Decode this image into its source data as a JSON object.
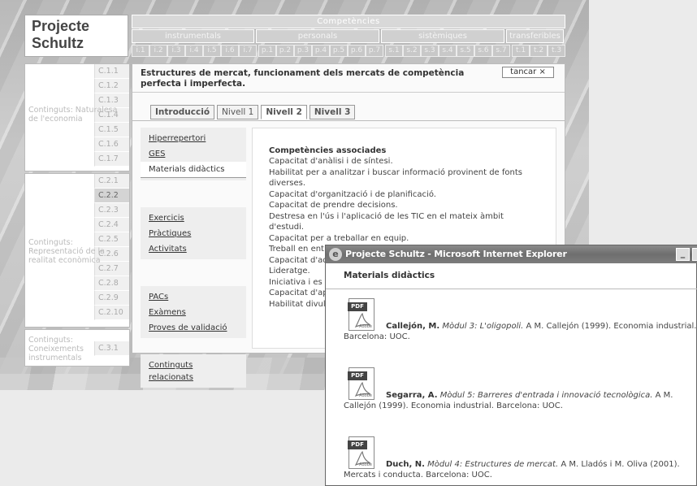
{
  "logo": {
    "line1": "Projecte",
    "line2": "Schultz"
  },
  "competencies": {
    "title": "Competències",
    "categories": [
      "instrumentals",
      "personals",
      "sistèmiques",
      "transferibles"
    ],
    "codes": [
      "i.1",
      "i.2",
      "i.3",
      "i.4",
      "i.5",
      "i.6",
      "i.7",
      "p.1",
      "p.2",
      "p.3",
      "p.4",
      "p.5",
      "p.6",
      "p.7",
      "s.1",
      "s.2",
      "s.3",
      "s.4",
      "s.5",
      "s.6",
      "s.7",
      "t.1",
      "t.2",
      "t.3"
    ]
  },
  "sections": [
    {
      "label": "Continguts: Naturalesa de l'economia",
      "codes": [
        "C.1.1",
        "C.1.2",
        "C.1.3",
        "C.1.4",
        "C.1.5",
        "C.1.6",
        "C.1.7"
      ]
    },
    {
      "label": "Continguts: Representació de la realitat econòmica",
      "codes": [
        "C.2.1",
        "C.2.2",
        "C.2.3",
        "C.2.4",
        "C.2.5",
        "C.2.6",
        "C.2.7",
        "C.2.8",
        "C.2.9",
        "C.2.10"
      ],
      "active": "C.2.2"
    },
    {
      "label": "Continguts: Coneixements instrumentals",
      "codes": [
        "C.3.1"
      ]
    }
  ],
  "main": {
    "title": "Estructures de mercat, funcionament dels mercats de competència perfecta i imperfecta.",
    "close_label": "tancar ×",
    "tabs": [
      "Introducció",
      "Nivell 1",
      "Nivell 2",
      "Nivell 3"
    ],
    "active_tab": "Nivell 2",
    "links_group1": [
      "Hiperrepertori",
      "GES",
      "Materials didàctics"
    ],
    "links_group2": [
      "Exercicis",
      "Pràctiques",
      "Activitats"
    ],
    "links_group3": [
      "PACs",
      "Exàmens",
      "Proves de validació"
    ],
    "links_group4": [
      "Continguts relacionats"
    ],
    "assoc_title": "Competències associades",
    "assoc_items": [
      "Capacitat d'anàlisi i de síntesi.",
      "Habilitat per a analitzar i buscar informació provinent de fonts diverses.",
      "Capacitat d'organització i de planificació.",
      "Capacitat de prendre decisions.",
      "Destresa en l'ús i l'aplicació de les TIC en el mateix àmbit d'estudi.",
      "Capacitat per a treballar en equip.",
      "Treball en ent",
      "Capacitat d'ad",
      "Lideratge.",
      "Iniciativa i es",
      "Capacitat d'ap",
      "Habilitat divul"
    ]
  },
  "popup": {
    "window_title": "Projecte Schultz - Microsoft Internet Explorer",
    "heading": "Materials didàctics",
    "pdf_label": "PDF",
    "adobe_label": "Adobe",
    "references": [
      {
        "author": "Callejón, M.",
        "work": "Mòdul 3: L'oligopoli.",
        "rest": "A M. Callejón (1999). Economia industrial. Barcelona: UOC."
      },
      {
        "author": "Segarra, A.",
        "work": "Mòdul 5: Barreres d'entrada i innovació tecnològica.",
        "rest": "A M. Callejón (1999). Economia industrial. Barcelona: UOC."
      },
      {
        "author": "Duch, N.",
        "work": "Mòdul 4: Estructures de mercat.",
        "rest": "A M. Lladós i M. Oliva (2001). Mercats i conducta. Barcelona: UOC."
      }
    ]
  }
}
